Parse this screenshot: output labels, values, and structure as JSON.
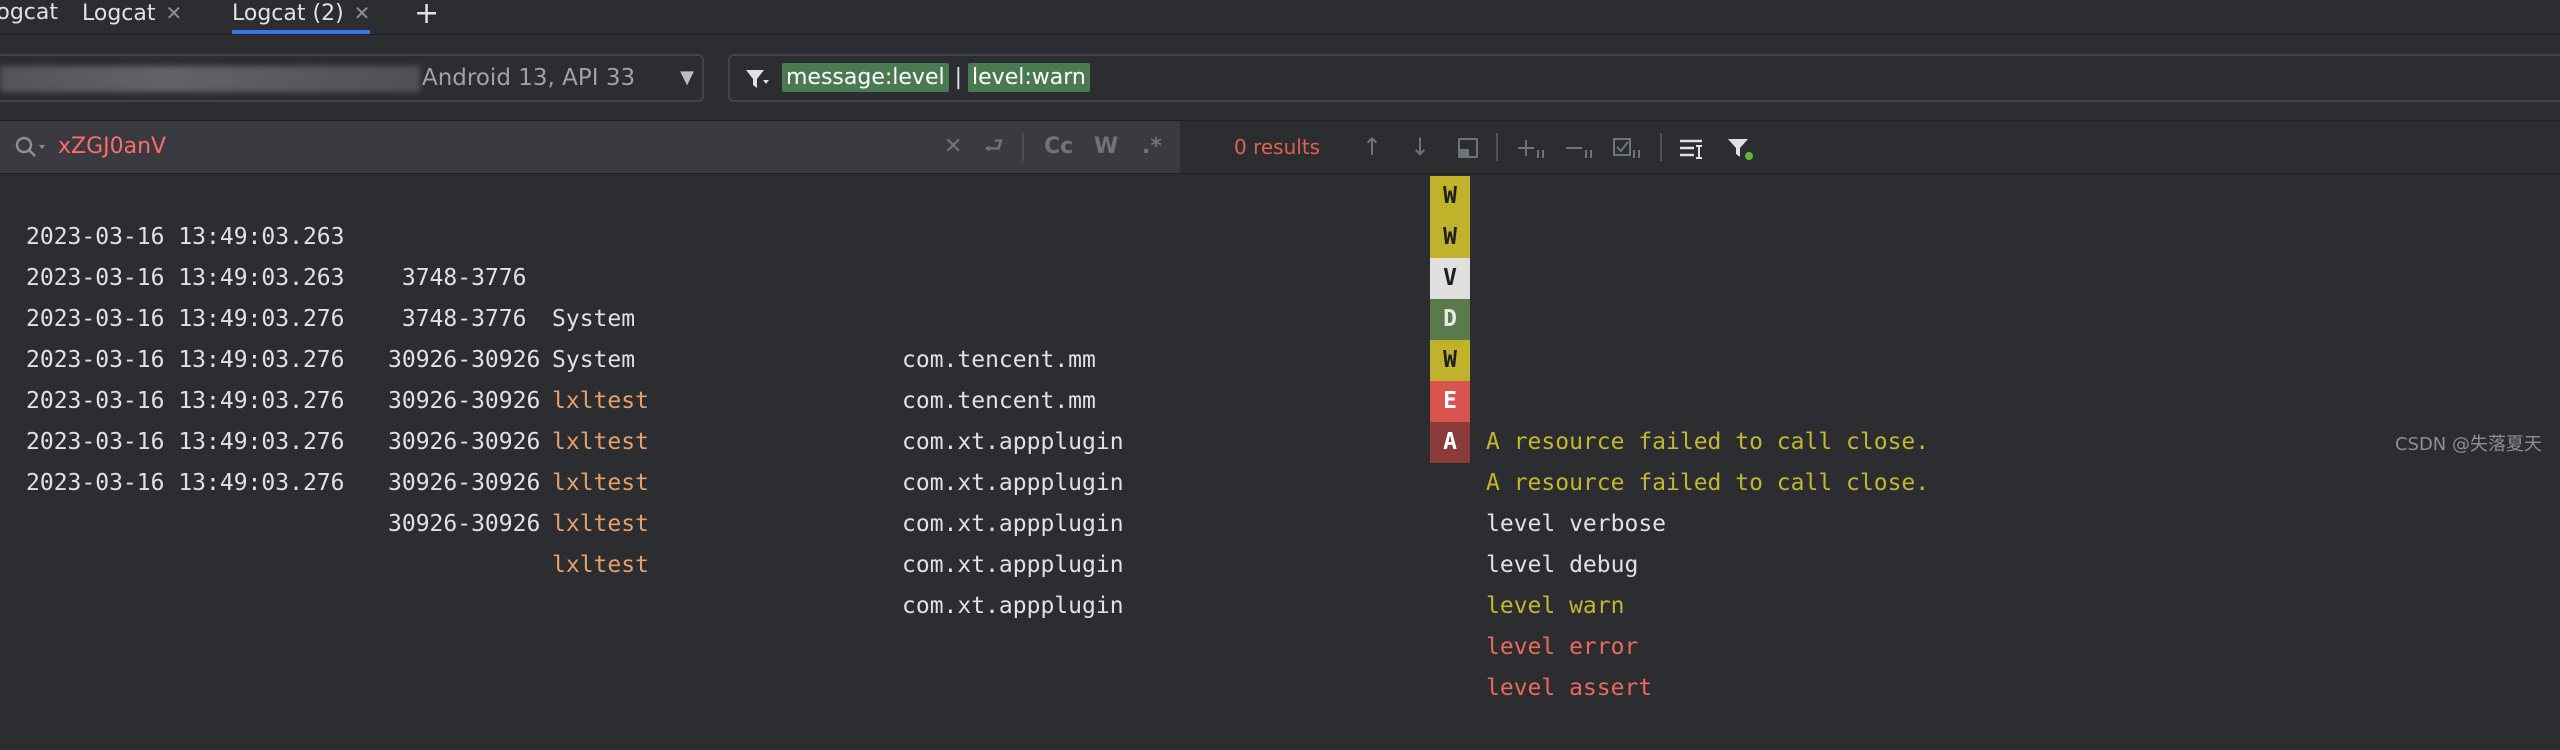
{
  "tabbar": {
    "window_label": "Logcat:",
    "tabs": [
      {
        "label": "Logcat",
        "active": false
      },
      {
        "label": "Logcat (2)",
        "active": true
      }
    ],
    "add_label": "+"
  },
  "device": {
    "text": "Android 13, API 33",
    "arrow": "▼"
  },
  "filter": {
    "term1": "message:level",
    "pipe": "|",
    "term2": "level:warn"
  },
  "search": {
    "value": "xZGJ0anV",
    "clear": "✕",
    "match_case": "Cc",
    "words": "W",
    "regex": ".*",
    "results": "0 results"
  },
  "log": {
    "rows": [
      {
        "date": "2023-03-16 13:49:03.263",
        "pid": " 3748-3776",
        "tag": "System",
        "pkg": "com.tencent.mm",
        "level": "W",
        "msg": "A resource failed to call close."
      },
      {
        "date": "2023-03-16 13:49:03.263",
        "pid": " 3748-3776",
        "tag": "System",
        "pkg": "com.tencent.mm",
        "level": "W",
        "msg": "A resource failed to call close."
      },
      {
        "date": "2023-03-16 13:49:03.276",
        "pid": "30926-30926",
        "tag": "lxltest",
        "pkg": "com.xt.appplugin",
        "level": "V",
        "msg": "level verbose"
      },
      {
        "date": "2023-03-16 13:49:03.276",
        "pid": "30926-30926",
        "tag": "lxltest",
        "pkg": "com.xt.appplugin",
        "level": "D",
        "msg": "level debug"
      },
      {
        "date": "2023-03-16 13:49:03.276",
        "pid": "30926-30926",
        "tag": "lxltest",
        "pkg": "com.xt.appplugin",
        "level": "W",
        "msg": "level warn"
      },
      {
        "date": "2023-03-16 13:49:03.276",
        "pid": "30926-30926",
        "tag": "lxltest",
        "pkg": "com.xt.appplugin",
        "level": "E",
        "msg": "level error"
      },
      {
        "date": "2023-03-16 13:49:03.276",
        "pid": "30926-30926",
        "tag": "lxltest",
        "pkg": "com.xt.appplugin",
        "level": "A",
        "msg": "level assert"
      }
    ]
  },
  "watermark": "CSDN @失落夏天",
  "colors": {
    "accent": "#3574f0",
    "warn": "#c0b22a",
    "error": "#d9534f",
    "filter_highlight": "#4a7a52"
  }
}
